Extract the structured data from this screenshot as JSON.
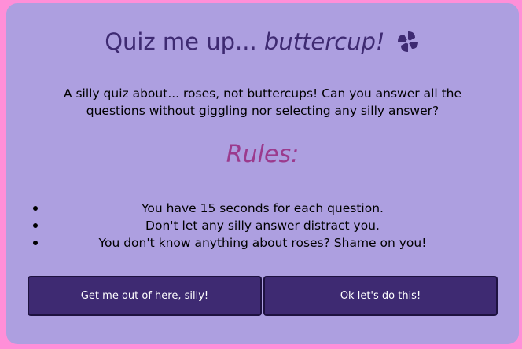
{
  "title": {
    "text_plain": "Quiz me up... ",
    "text_italic": "buttercup!",
    "icon": "pinwheel-icon"
  },
  "intro": "A silly quiz about... roses, not buttercups! Can you answer all the questions without giggling nor selecting any silly answer?",
  "rules": {
    "heading": "Rules:",
    "items": [
      "You have 15 seconds for each question.",
      "Don't let any silly answer distract you.",
      "You don't know anything about roses? Shame on you!"
    ]
  },
  "buttons": {
    "exit_label": "Get me out of here, silly!",
    "start_label": "Ok let's do this!"
  },
  "colors": {
    "page_background": "#ff8fd8",
    "card_background": "#ad9fe0",
    "title": "#3e2a72",
    "rules_heading": "#9b3a8d",
    "button": "#3e2a72"
  }
}
